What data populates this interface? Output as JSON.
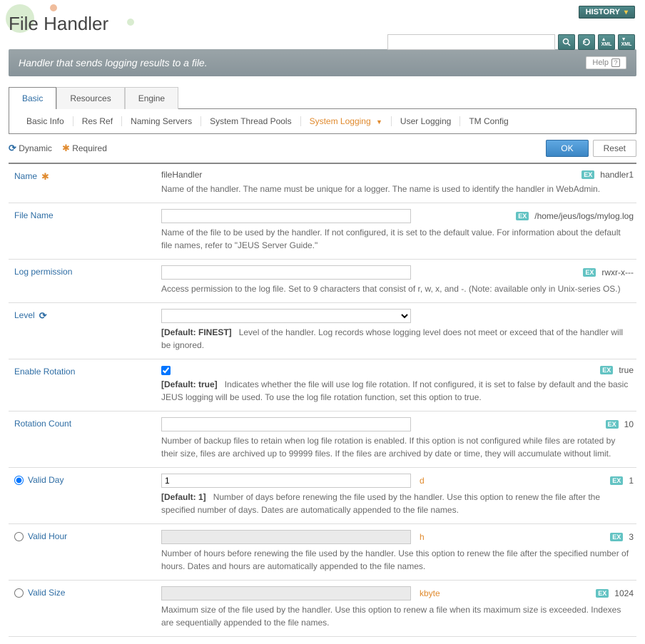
{
  "header": {
    "title": "File Handler",
    "history": "HISTORY",
    "description": "Handler that sends logging results to a file.",
    "help": "Help"
  },
  "search": {
    "placeholder": ""
  },
  "tabs": {
    "basic": "Basic",
    "resources": "Resources",
    "engine": "Engine"
  },
  "subtabs": {
    "basic_info": "Basic Info",
    "res_ref": "Res Ref",
    "naming_servers": "Naming Servers",
    "system_thread_pools": "System Thread Pools",
    "system_logging": "System Logging",
    "user_logging": "User Logging",
    "tm_config": "TM Config"
  },
  "legend": {
    "dynamic": "Dynamic",
    "required": "Required"
  },
  "buttons": {
    "ok": "OK",
    "reset": "Reset"
  },
  "ex_label": "EX",
  "fields": {
    "name": {
      "label": "Name",
      "value": "fileHandler",
      "example": "handler1",
      "desc": "Name of the handler. The name must be unique for a logger. The name is used to identify the handler in WebAdmin."
    },
    "file_name": {
      "label": "File Name",
      "example": "/home/jeus/logs/mylog.log",
      "desc": "Name of the file to be used by the handler. If not configured, it is set to the default value. For information about the default file names, refer to \"JEUS Server Guide.\""
    },
    "log_permission": {
      "label": "Log permission",
      "example": "rwxr-x---",
      "desc": "Access permission to the log file. Set to 9 characters that consist of r, w, x, and -. (Note: available only in Unix-series OS.)"
    },
    "level": {
      "label": "Level",
      "default": "[Default: FINEST]",
      "desc": "Level of the handler. Log records whose logging level does not meet or exceed that of the handler will be ignored."
    },
    "enable_rotation": {
      "label": "Enable Rotation",
      "example": "true",
      "default": "[Default: true]",
      "desc": "Indicates whether the file will use log file rotation. If not configured, it is set to false by default and the basic JEUS logging will be used. To use the log file rotation function, set this option to true."
    },
    "rotation_count": {
      "label": "Rotation Count",
      "example": "10",
      "desc": "Number of backup files to retain when log file rotation is enabled. If this option is not configured while files are rotated by their size, files are archived up to 99999 files. If the files are archived by date or time, they will accumulate without limit."
    },
    "valid_day": {
      "label": "Valid Day",
      "value": "1",
      "unit": "d",
      "example": "1",
      "default": "[Default: 1]",
      "desc": "Number of days before renewing the file used by the handler. Use this option to renew the file after the specified number of days. Dates are automatically appended to the file names."
    },
    "valid_hour": {
      "label": "Valid Hour",
      "unit": "h",
      "example": "3",
      "desc": "Number of hours before renewing the file used by the handler. Use this option to renew the file after the specified number of hours. Dates and hours are automatically appended to the file names."
    },
    "valid_size": {
      "label": "Valid Size",
      "unit": "kbyte",
      "example": "1024",
      "desc": "Maximum size of the file used by the handler. Use this option to renew a file when its maximum size is exceeded. Indexes are sequentially appended to the file names."
    }
  }
}
